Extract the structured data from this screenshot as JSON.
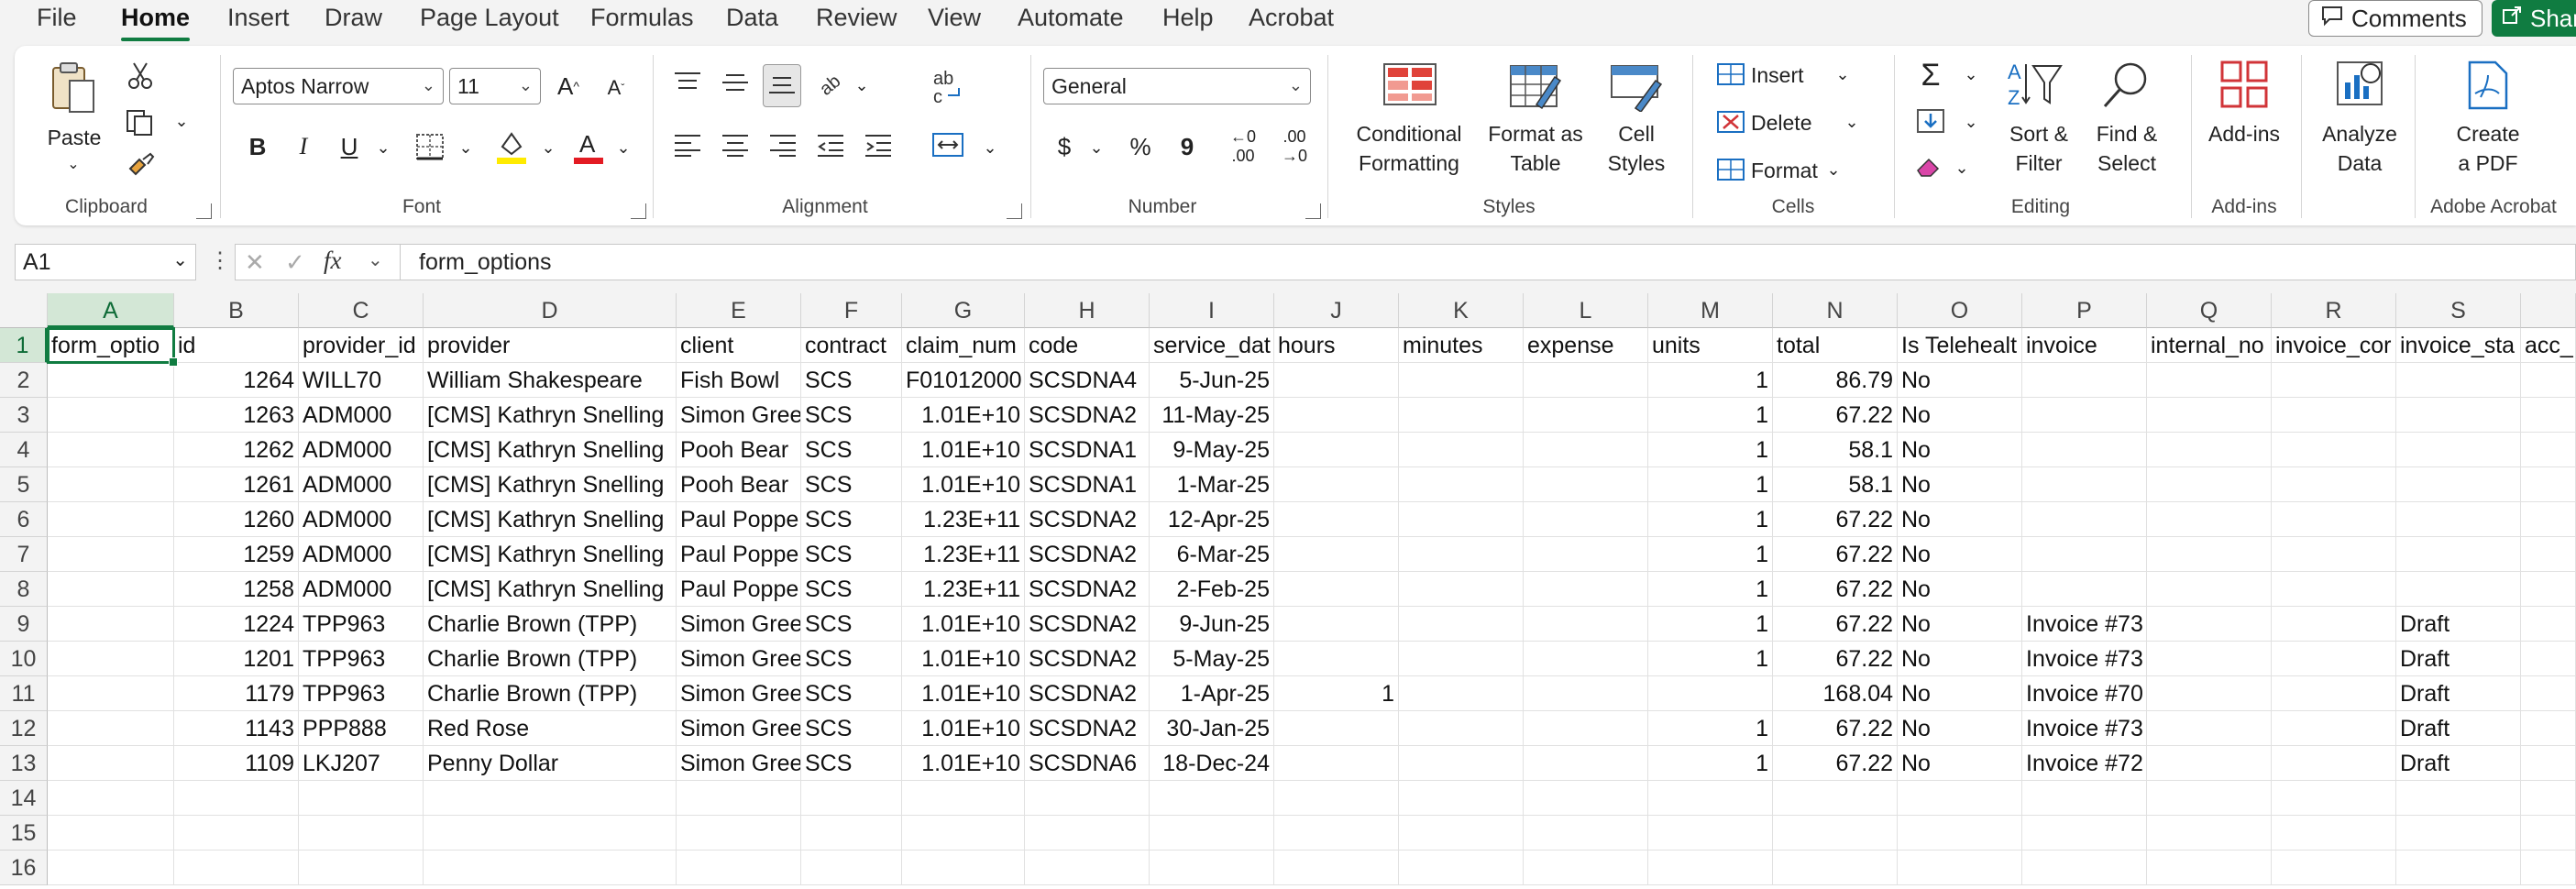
{
  "menu": {
    "tabs": [
      "File",
      "Home",
      "Insert",
      "Draw",
      "Page Layout",
      "Formulas",
      "Data",
      "Review",
      "View",
      "Automate",
      "Help",
      "Acrobat"
    ],
    "active": "Home",
    "comments_label": "Comments",
    "share_label": "Share"
  },
  "ribbon": {
    "clipboard": {
      "paste_label": "Paste",
      "group_label": "Clipboard"
    },
    "font": {
      "font_name": "Aptos Narrow",
      "font_size": "11",
      "group_label": "Font",
      "bold": "B",
      "italic": "I",
      "underline": "U"
    },
    "alignment": {
      "group_label": "Alignment"
    },
    "number": {
      "format": "General",
      "group_label": "Number",
      "currency": "$",
      "percent": "%",
      "comma": "9",
      "inc_decimal": ".00",
      "dec_decimal": ".00"
    },
    "styles": {
      "conditional_l1": "Conditional",
      "conditional_l2": "Formatting",
      "format_table_l1": "Format as",
      "format_table_l2": "Table",
      "cell_styles_l1": "Cell",
      "cell_styles_l2": "Styles",
      "group_label": "Styles"
    },
    "cells": {
      "insert": "Insert",
      "delete": "Delete",
      "format": "Format",
      "group_label": "Cells"
    },
    "editing": {
      "sum": "Σ",
      "sort_l1": "Sort &",
      "sort_l2": "Filter",
      "find_l1": "Find &",
      "find_l2": "Select",
      "group_label": "Editing"
    },
    "addins": {
      "label": "Add-ins",
      "group_label": "Add-ins"
    },
    "analyze": {
      "label_l1": "Analyze",
      "label_l2": "Data"
    },
    "acrobat": {
      "label_l1": "Create",
      "label_l2": "a PDF",
      "group_label": "Adobe Acrobat"
    }
  },
  "formula_bar": {
    "name_box": "A1",
    "fx": "fx",
    "content": "form_options"
  },
  "sheet": {
    "columns": [
      "A",
      "B",
      "C",
      "D",
      "E",
      "F",
      "G",
      "H",
      "I",
      "J",
      "K",
      "L",
      "M",
      "N",
      "O",
      "P",
      "Q",
      "R",
      "S"
    ],
    "selected_column": "A",
    "rows": [
      [
        "form_optio",
        "id",
        "provider_id",
        "provider",
        "client",
        "contract",
        "claim_num",
        "code",
        "service_dat",
        "hours",
        "minutes",
        "expense",
        "units",
        "total",
        "Is Telehealt",
        "invoice",
        "internal_no",
        "invoice_cor",
        "invoice_sta",
        "acc_"
      ],
      [
        "",
        "1264",
        "WILL70",
        "William Shakespeare",
        "Fish Bowl",
        "SCS",
        "F01012000",
        "SCSDNA4",
        "5-Jun-25",
        "",
        "",
        "",
        "1",
        "86.79",
        "No",
        "",
        "",
        "",
        "",
        ""
      ],
      [
        "",
        "1263",
        "ADM000",
        "[CMS] Kathryn Snelling",
        "Simon Gree",
        "SCS",
        "1.01E+10",
        "SCSDNA2",
        "11-May-25",
        "",
        "",
        "",
        "1",
        "67.22",
        "No",
        "",
        "",
        "",
        "",
        ""
      ],
      [
        "",
        "1262",
        "ADM000",
        "[CMS] Kathryn Snelling",
        "Pooh Bear",
        "SCS",
        "1.01E+10",
        "SCSDNA1",
        "9-May-25",
        "",
        "",
        "",
        "1",
        "58.1",
        "No",
        "",
        "",
        "",
        "",
        ""
      ],
      [
        "",
        "1261",
        "ADM000",
        "[CMS] Kathryn Snelling",
        "Pooh Bear",
        "SCS",
        "1.01E+10",
        "SCSDNA1",
        "1-Mar-25",
        "",
        "",
        "",
        "1",
        "58.1",
        "No",
        "",
        "",
        "",
        "",
        ""
      ],
      [
        "",
        "1260",
        "ADM000",
        "[CMS] Kathryn Snelling",
        "Paul Poppe",
        "SCS",
        "1.23E+11",
        "SCSDNA2",
        "12-Apr-25",
        "",
        "",
        "",
        "1",
        "67.22",
        "No",
        "",
        "",
        "",
        "",
        ""
      ],
      [
        "",
        "1259",
        "ADM000",
        "[CMS] Kathryn Snelling",
        "Paul Poppe",
        "SCS",
        "1.23E+11",
        "SCSDNA2",
        "6-Mar-25",
        "",
        "",
        "",
        "1",
        "67.22",
        "No",
        "",
        "",
        "",
        "",
        ""
      ],
      [
        "",
        "1258",
        "ADM000",
        "[CMS] Kathryn Snelling",
        "Paul Poppe",
        "SCS",
        "1.23E+11",
        "SCSDNA2",
        "2-Feb-25",
        "",
        "",
        "",
        "1",
        "67.22",
        "No",
        "",
        "",
        "",
        "",
        ""
      ],
      [
        "",
        "1224",
        "TPP963",
        "Charlie Brown (TPP)",
        "Simon Gree",
        "SCS",
        "1.01E+10",
        "SCSDNA2",
        "9-Jun-25",
        "",
        "",
        "",
        "1",
        "67.22",
        "No",
        "Invoice #73",
        "",
        "",
        "Draft",
        ""
      ],
      [
        "",
        "1201",
        "TPP963",
        "Charlie Brown (TPP)",
        "Simon Gree",
        "SCS",
        "1.01E+10",
        "SCSDNA2",
        "5-May-25",
        "",
        "",
        "",
        "1",
        "67.22",
        "No",
        "Invoice #73",
        "",
        "",
        "Draft",
        ""
      ],
      [
        "",
        "1179",
        "TPP963",
        "Charlie Brown (TPP)",
        "Simon Gree",
        "SCS",
        "1.01E+10",
        "SCSDNA2",
        "1-Apr-25",
        "1",
        "",
        "",
        "",
        "168.04",
        "No",
        "Invoice #70",
        "",
        "",
        "Draft",
        ""
      ],
      [
        "",
        "1143",
        "PPP888",
        "Red Rose",
        "Simon Gree",
        "SCS",
        "1.01E+10",
        "SCSDNA2",
        "30-Jan-25",
        "",
        "",
        "",
        "1",
        "67.22",
        "No",
        "Invoice #73",
        "",
        "",
        "Draft",
        ""
      ],
      [
        "",
        "1109",
        "LKJ207",
        "Penny Dollar",
        "Simon Gree",
        "SCS",
        "1.01E+10",
        "SCSDNA6",
        "18-Dec-24",
        "",
        "",
        "",
        "1",
        "67.22",
        "No",
        "Invoice #72",
        "",
        "",
        "Draft",
        ""
      ],
      [
        "",
        "",
        "",
        "",
        "",
        "",
        "",
        "",
        "",
        "",
        "",
        "",
        "",
        "",
        "",
        "",
        "",
        "",
        "",
        ""
      ],
      [
        "",
        "",
        "",
        "",
        "",
        "",
        "",
        "",
        "",
        "",
        "",
        "",
        "",
        "",
        "",
        "",
        "",
        "",
        "",
        ""
      ],
      [
        "",
        "",
        "",
        "",
        "",
        "",
        "",
        "",
        "",
        "",
        "",
        "",
        "",
        "",
        "",
        "",
        "",
        "",
        "",
        ""
      ]
    ]
  },
  "colors": {
    "accent": "#107c41",
    "select_bg": "#d3e7d6"
  }
}
